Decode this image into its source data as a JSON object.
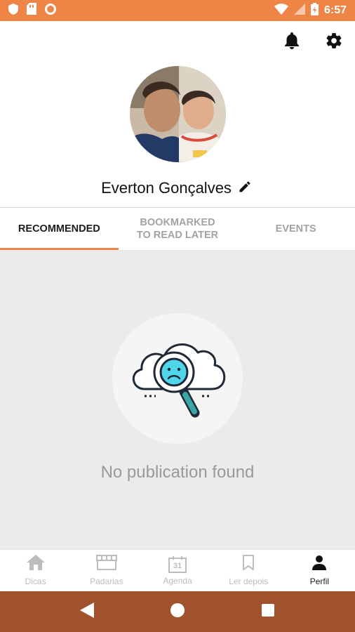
{
  "status_bar": {
    "time": "6:57",
    "icons": [
      "shield-icon",
      "sim-card-icon",
      "circle-icon",
      "wifi-icon",
      "signal-icon",
      "battery-icon"
    ],
    "color": "#ee8446"
  },
  "header": {
    "notification_icon": "bell-icon",
    "settings_icon": "gear-icon"
  },
  "profile": {
    "name": "Everton Gonçalves",
    "edit_icon": "pencil-icon"
  },
  "tabs": [
    {
      "label": "RECOMMENDED",
      "active": true
    },
    {
      "label": "BOOKMARKED TO READ LATER",
      "active": false
    },
    {
      "label": "EVENTS",
      "active": false
    }
  ],
  "empty_state": {
    "message": "No publication found",
    "icon": "cloud-search-sad-icon"
  },
  "bottom_nav": [
    {
      "label": "Dicas",
      "icon": "home-icon",
      "active": false
    },
    {
      "label": "Padarias",
      "icon": "store-icon",
      "active": false
    },
    {
      "label": "Agenda",
      "icon": "calendar-icon",
      "calendar_day": "31",
      "active": false
    },
    {
      "label": "Ler depois",
      "icon": "bookmark-icon",
      "active": false
    },
    {
      "label": "Perfil",
      "icon": "person-icon",
      "active": true
    }
  ],
  "colors": {
    "accent": "#ee8446",
    "system_nav": "#a0522d",
    "content_bg": "#ebebeb"
  }
}
